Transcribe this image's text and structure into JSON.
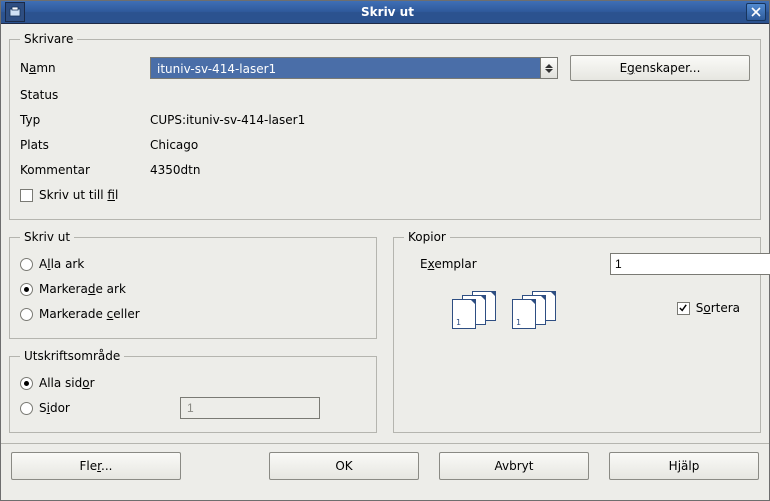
{
  "window": {
    "title": "Skriv ut"
  },
  "printer": {
    "legend": "Skrivare",
    "name_label_pre": "N",
    "name_label_u": "a",
    "name_label_post": "mn",
    "name_value": "ituniv-sv-414-laser1",
    "properties_pre": "E",
    "properties_u": "g",
    "properties_post": "enskaper...",
    "status_label": "Status",
    "status_value": "",
    "type_label": "Typ",
    "type_value": "CUPS:ituniv-sv-414-laser1",
    "location_label": "Plats",
    "location_value": "Chicago",
    "comment_label": "Kommentar",
    "comment_value": "4350dtn",
    "to_file_pre": "Skriv ut till ",
    "to_file_u": "f",
    "to_file_post": "il"
  },
  "printwhat": {
    "legend": "Skriv ut",
    "all_pre": "A",
    "all_u": "l",
    "all_post": "la ark",
    "selrows_pre": "Markera",
    "selrows_u": "d",
    "selrows_post": "e ark",
    "selcells_pre": "Markerade ",
    "selcells_u": "c",
    "selcells_post": "eller"
  },
  "range": {
    "legend": "Utskriftsområde",
    "all_pre": "Alla sid",
    "all_u": "o",
    "all_post": "r",
    "pages_pre": "S",
    "pages_u": "i",
    "pages_post": "dor",
    "pages_value": "1"
  },
  "copies": {
    "legend": "Kopior",
    "exemplar_pre": "E",
    "exemplar_u": "x",
    "exemplar_post": "emplar",
    "value": "1",
    "sort_pre": "S",
    "sort_u": "o",
    "sort_post": "rtera"
  },
  "buttons": {
    "more_pre": "Fle",
    "more_u": "r",
    "more_post": "...",
    "ok": "OK",
    "cancel": "Avbryt",
    "help_pre": "H",
    "help_u": "j",
    "help_post": "älp"
  }
}
